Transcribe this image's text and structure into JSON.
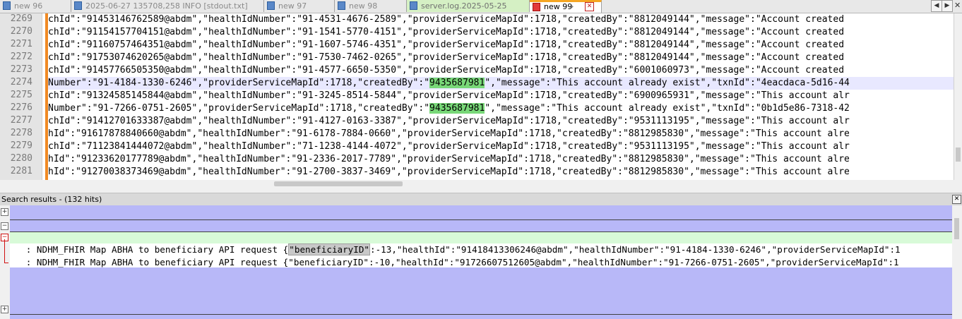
{
  "tabs": [
    {
      "label": "new 96",
      "state": "inactive"
    },
    {
      "label": "2025-06-27 135708,258 INFO  [stdout.txt]",
      "state": "inactive"
    },
    {
      "label": "new 97",
      "state": "inactive"
    },
    {
      "label": "new 98",
      "state": "inactive"
    },
    {
      "label": "server.log.2025-05-25",
      "state": "inactive-green"
    },
    {
      "label": "new 99",
      "state": "active"
    }
  ],
  "tab_nav": {
    "left": "◀",
    "right": "▶",
    "close": "✕"
  },
  "editor": {
    "lines": [
      {
        "num": "2269",
        "pre": "chId\":\"91453146762589@abdm\",\"healthIdNumber\":\"91-4531-4676-2589\",\"providerServiceMapId\":1718,\"createdBy\":\"8812049144\",\"message\":\"Account created",
        "hl": "",
        "post": ""
      },
      {
        "num": "2270",
        "pre": "chId\":\"91154157704151@abdm\",\"healthIdNumber\":\"91-1541-5770-4151\",\"providerServiceMapId\":1718,\"createdBy\":\"8812049144\",\"message\":\"Account created",
        "hl": "",
        "post": ""
      },
      {
        "num": "2271",
        "pre": "chId\":\"91160757464351@abdm\",\"healthIdNumber\":\"91-1607-5746-4351\",\"providerServiceMapId\":1718,\"createdBy\":\"8812049144\",\"message\":\"Account created",
        "hl": "",
        "post": ""
      },
      {
        "num": "2272",
        "pre": "chId\":\"91753074620265@abdm\",\"healthIdNumber\":\"91-7530-7462-0265\",\"providerServiceMapId\":1718,\"createdBy\":\"8812049144\",\"message\":\"Account created",
        "hl": "",
        "post": ""
      },
      {
        "num": "2273",
        "pre": "chId\":\"91457766505350@abdm\",\"healthIdNumber\":\"91-4577-6650-5350\",\"providerServiceMapId\":1718,\"createdBy\":\"6001060973\",\"message\":\"Account created",
        "hl": "",
        "post": ""
      },
      {
        "num": "2274",
        "pre": "Number\":\"91-4184-1330-6246\",\"providerServiceMapId\":1718,\"createdBy\":\"",
        "hl": "9435687981",
        "post": "\",\"message\":\"This account already exist\",\"txnId\":\"4eacdaca-5d16-44"
      },
      {
        "num": "2275",
        "pre": "chId\":\"91324585145844@abdm\",\"healthIdNumber\":\"91-3245-8514-5844\",\"providerServiceMapId\":1718,\"createdBy\":\"6900965931\",\"message\":\"This account alr",
        "hl": "",
        "post": ""
      },
      {
        "num": "2276",
        "pre": "Number\":\"91-7266-0751-2605\",\"providerServiceMapId\":1718,\"createdBy\":\"",
        "hl": "9435687981",
        "post": "\",\"message\":\"This account already exist\",\"txnId\":\"0b1d5e86-7318-42"
      },
      {
        "num": "2277",
        "pre": "chId\":\"91412701633387@abdm\",\"healthIdNumber\":\"91-4127-0163-3387\",\"providerServiceMapId\":1718,\"createdBy\":\"9531113195\",\"message\":\"This account alr",
        "hl": "",
        "post": ""
      },
      {
        "num": "2278",
        "pre": "hId\":\"91617878840660@abdm\",\"healthIdNumber\":\"91-6178-7884-0660\",\"providerServiceMapId\":1718,\"createdBy\":\"8812985830\",\"message\":\"This account alre",
        "hl": "",
        "post": ""
      },
      {
        "num": "2279",
        "pre": "chId\":\"71123841444072@abdm\",\"healthIdNumber\":\"71-1238-4144-4072\",\"providerServiceMapId\":1718,\"createdBy\":\"9531113195\",\"message\":\"This account alr",
        "hl": "",
        "post": ""
      },
      {
        "num": "2280",
        "pre": "hId\":\"91233620177789@abdm\",\"healthIdNumber\":\"91-2336-2017-7789\",\"providerServiceMapId\":1718,\"createdBy\":\"8812985830\",\"message\":\"This account alre",
        "hl": "",
        "post": ""
      },
      {
        "num": "2281",
        "pre": "hId\":\"91270038373469@abdm\",\"healthIdNumber\":\"91-2700-3837-3469\",\"providerServiceMapId\":1718,\"createdBy\":\"8812985830\",\"message\":\"This account alre",
        "hl": "",
        "post": ""
      }
    ]
  },
  "search": {
    "header": "Search results - (132 hits)",
    "close": "✕",
    "results": [
      {
        "pre": "   : NDHM_FHIR Map ABHA to beneficiary API request {",
        "hl": "\"beneficiaryID\"",
        "post": ":-13,\"healthId\":\"91418413306246@abdm\",\"healthIdNumber\":\"91-4184-1330-6246\",\"providerServiceMapId\":1"
      },
      {
        "pre": "   : NDHM_FHIR Map ABHA to beneficiary API request {",
        "hl": "\"beneficiaryID\"",
        "post": ":-10,\"healthId\":\"91726607512605@abdm\",\"healthIdNumber\":\"91-7266-0751-2605\",\"providerServiceMapId\":1"
      }
    ]
  },
  "colors": {
    "search_band": "#b8b8f8",
    "file_band": "#d8fad8",
    "match_highlight": "#78d878",
    "active_tab_accent": "#f5a623"
  }
}
